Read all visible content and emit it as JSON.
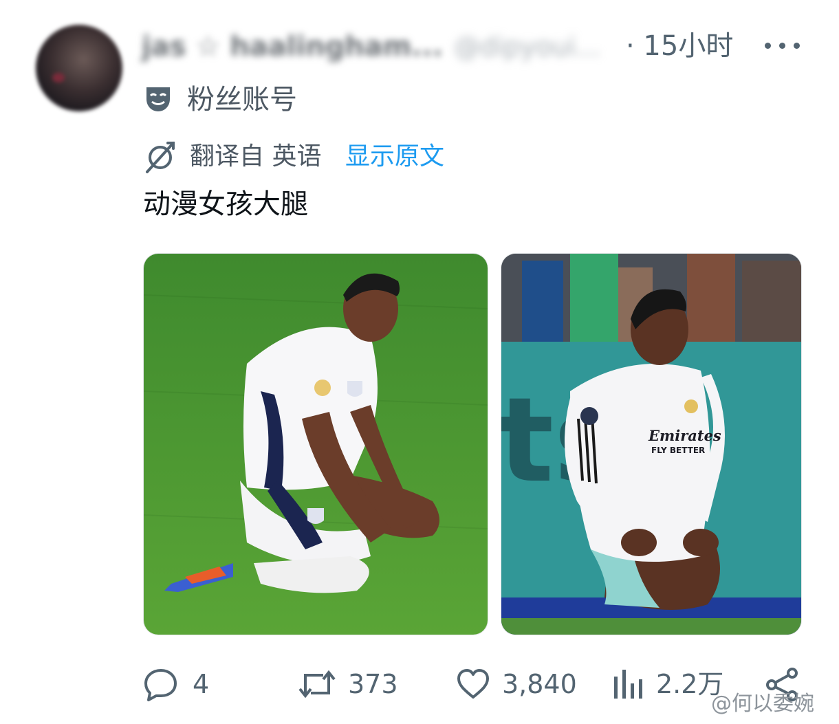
{
  "post": {
    "author_name": "jas ☆ haalingham...",
    "author_handle": "@dipyoui...",
    "time": "· 15小时",
    "account_badge": "粉丝账号",
    "translated_from": "翻译自 英语",
    "show_original": "显示原文",
    "text": "动漫女孩大腿"
  },
  "media": {
    "left_jersey_text": "",
    "right_jersey_line1": "Emirates",
    "right_jersey_line2": "FLY BETTER"
  },
  "actions": {
    "replies": "4",
    "reposts": "373",
    "likes": "3,840",
    "views": "2.2万"
  },
  "watermark": "@何以委婉",
  "colors": {
    "accent": "#1d9bf0",
    "muted_text": "#536471"
  },
  "icons": [
    "more-icon",
    "mask-icon",
    "translate-icon",
    "reply-icon",
    "repost-icon",
    "like-icon",
    "views-icon",
    "share-icon"
  ]
}
